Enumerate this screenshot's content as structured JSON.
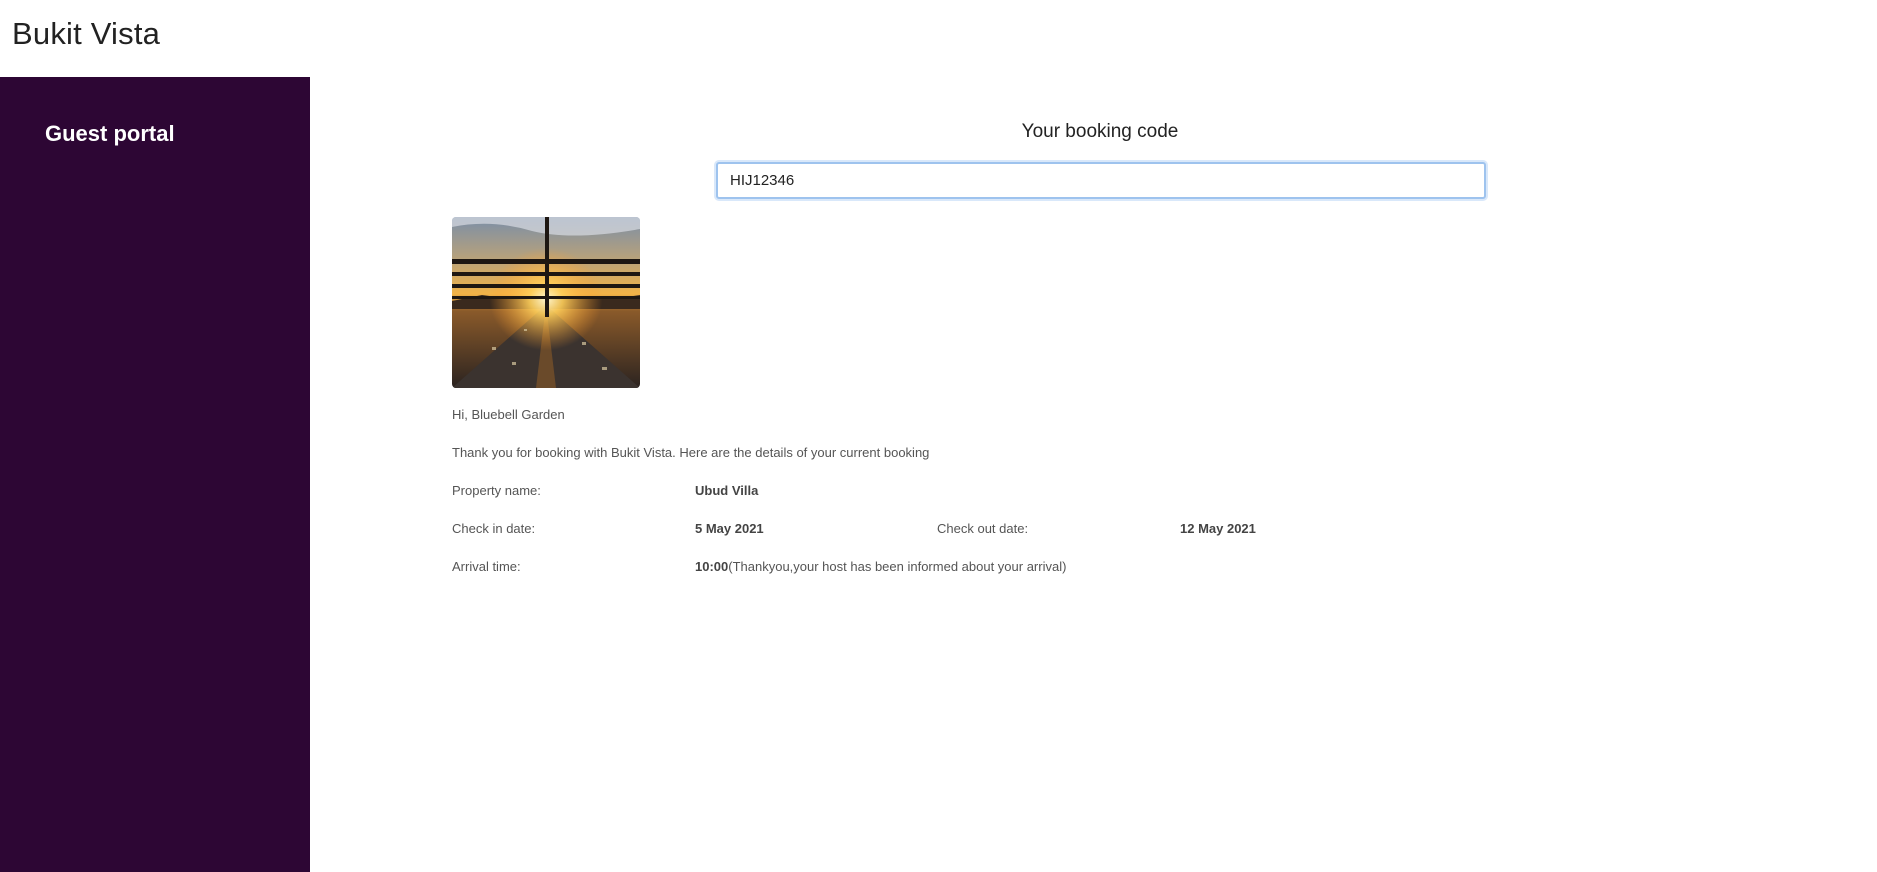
{
  "app": {
    "title": "Bukit Vista"
  },
  "sidebar": {
    "title": "Guest portal"
  },
  "booking": {
    "code_label": "Your booking code",
    "code_value": "HIJ12346"
  },
  "details": {
    "greeting": "Hi, Bluebell Garden",
    "thanks": "Thank you for booking with Bukit Vista. Here are the details of your current booking",
    "property_label": "Property name:",
    "property_value": "Ubud Villa",
    "checkin_label": "Check in date:",
    "checkin_value": "5 May 2021",
    "checkout_label": "Check out date:",
    "checkout_value": "12 May 2021",
    "arrival_label": "Arrival time:",
    "arrival_value": "10:00",
    "arrival_note": "(Thankyou,your host has been informed about your arrival)"
  },
  "colors": {
    "sidebar_bg": "#2d0634",
    "input_border": "#9ec3ee"
  },
  "image": {
    "subject": "sunset over highway through window blinds"
  }
}
